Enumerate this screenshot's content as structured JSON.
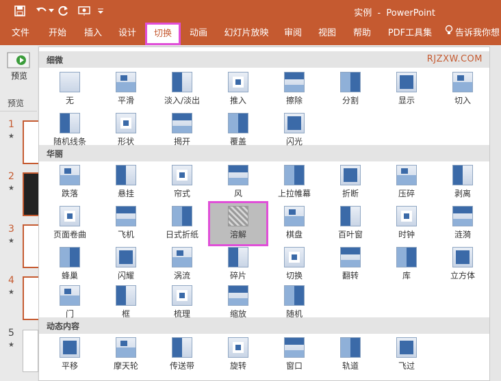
{
  "window": {
    "title": "实例  -  PowerPoint"
  },
  "quick_access": [
    "save-icon",
    "undo-icon",
    "redo-icon",
    "present-from-start-icon",
    "customize-qat-icon"
  ],
  "tabs": [
    {
      "label": "文件"
    },
    {
      "label": "开始"
    },
    {
      "label": "插入"
    },
    {
      "label": "设计"
    },
    {
      "label": "切换",
      "active": true
    },
    {
      "label": "动画"
    },
    {
      "label": "幻灯片放映"
    },
    {
      "label": "审阅"
    },
    {
      "label": "视图"
    },
    {
      "label": "帮助"
    },
    {
      "label": "PDF工具集"
    },
    {
      "label": "告诉我你想"
    }
  ],
  "left_panel": {
    "preview_label": "预览",
    "preview_group": "预览",
    "slides": [
      {
        "num": "1",
        "star": "★"
      },
      {
        "num": "2",
        "star": "★"
      },
      {
        "num": "3",
        "star": "★"
      },
      {
        "num": "4",
        "star": "★"
      },
      {
        "num": "5",
        "star": "★"
      }
    ]
  },
  "gallery": {
    "watermark": "RJZXW.COM",
    "sections": [
      {
        "title": "细微",
        "items": [
          "无",
          "平滑",
          "淡入/淡出",
          "推入",
          "擦除",
          "分割",
          "显示",
          "切入",
          "随机线条",
          "形状",
          "揭开",
          "覆盖",
          "闪光"
        ]
      },
      {
        "title": "华丽",
        "items": [
          "跌落",
          "悬挂",
          "帘式",
          "风",
          "上拉帷幕",
          "折断",
          "压碎",
          "剥离",
          "页面卷曲",
          "飞机",
          "日式折纸",
          "溶解",
          "棋盘",
          "百叶窗",
          "时钟",
          "涟漪",
          "蜂巢",
          "闪耀",
          "涡流",
          "碎片",
          "切换",
          "翻转",
          "库",
          "立方体",
          "门",
          "框",
          "梳理",
          "缩放",
          "随机"
        ]
      },
      {
        "title": "动态内容",
        "items": [
          "平移",
          "摩天轮",
          "传送带",
          "旋转",
          "窗口",
          "轨道",
          "飞过"
        ]
      }
    ],
    "highlighted": "溶解"
  },
  "colors": {
    "accent": "#c55a30",
    "highlight": "#e04fd8"
  }
}
